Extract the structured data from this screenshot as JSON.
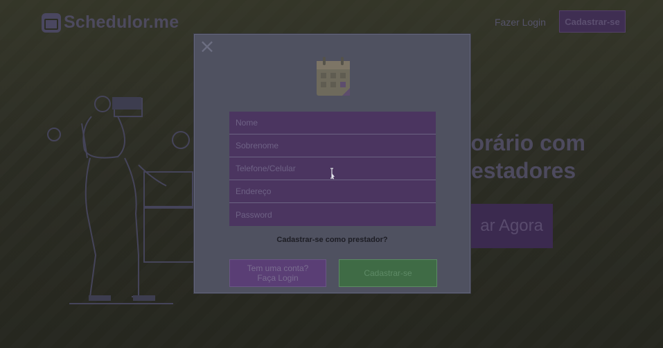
{
  "app": {
    "brand_name": "Schedulor.me"
  },
  "nav": {
    "login_label": "Fazer Login",
    "signup_label": "Cadastrar-se"
  },
  "hero": {
    "title_line1": "horário com",
    "title_line2": "estadores",
    "cta_label": "ar Agora"
  },
  "modal": {
    "close_symbol": "×",
    "icon": "calendar-icon",
    "fields": [
      {
        "name": "nome",
        "placeholder": "Nome"
      },
      {
        "name": "sobrenome",
        "placeholder": "Sobrenome"
      },
      {
        "name": "telefone",
        "placeholder": "Telefone/Celular"
      },
      {
        "name": "email",
        "placeholder": "Endereço"
      },
      {
        "name": "senha",
        "placeholder": "Password"
      }
    ],
    "provider_link": "Cadastrar-se como prestador?",
    "login_button": "Tem uma conta? Faça Login",
    "register_button": "Cadastrar-se"
  },
  "colors": {
    "overlay_bg": "#2c2d24",
    "modal_bg": "#4f5160",
    "form_purple": "#4b3560",
    "login_btn": "#5a3e75",
    "register_btn": "#3f6b45"
  }
}
